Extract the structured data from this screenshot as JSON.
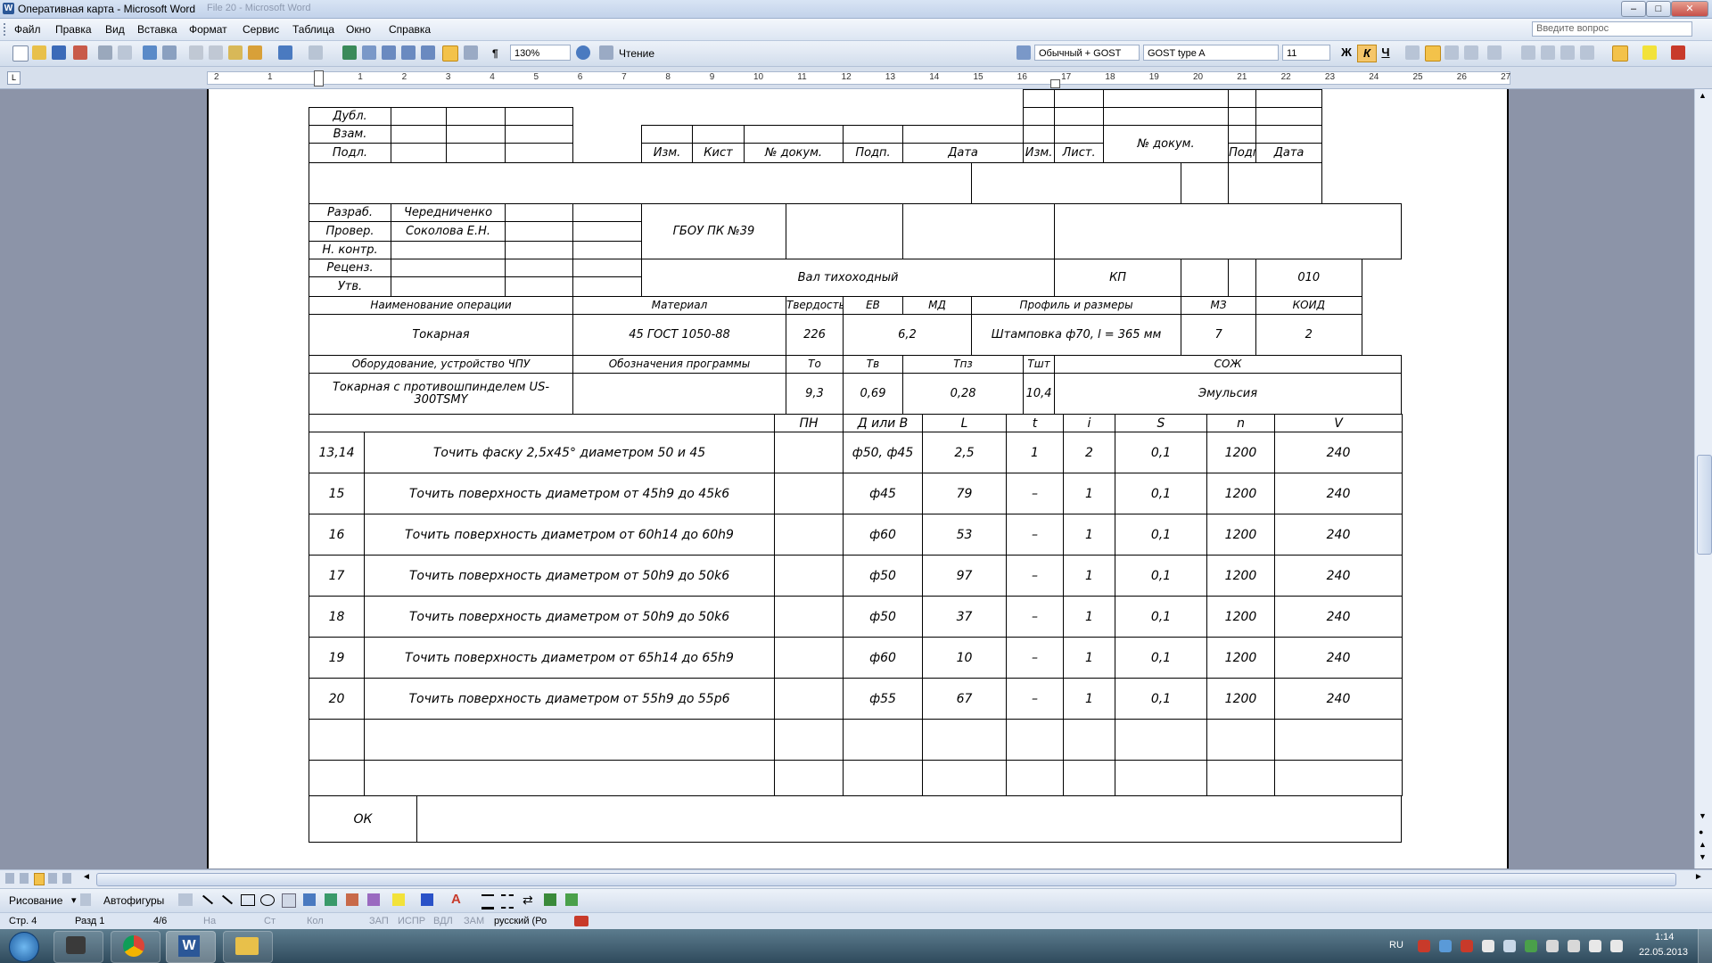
{
  "window": {
    "title": "Оперативная карта - Microsoft Word",
    "ghost_title": "File 20 - Microsoft Word",
    "minimize": "–",
    "maximize": "□",
    "close": "✕"
  },
  "menu": {
    "items": [
      "Файл",
      "Правка",
      "Вид",
      "Вставка",
      "Формат",
      "Сервис",
      "Таблица",
      "Окно",
      "Справка"
    ],
    "ask_placeholder": "Введите вопрос"
  },
  "toolbar": {
    "zoom": "130%",
    "reading_label": "Чтение",
    "style": "Обычный + GOST",
    "font": "GOST type A",
    "font_size": "11",
    "bold": "Ж",
    "italic": "К",
    "underline": "Ч"
  },
  "ruler": {
    "numbers": [
      "2",
      "1",
      "1",
      "2",
      "3",
      "4",
      "5",
      "6",
      "7",
      "8",
      "9",
      "10",
      "11",
      "12",
      "13",
      "14",
      "15",
      "16",
      "17",
      "18",
      "19",
      "20",
      "21",
      "22",
      "23",
      "24",
      "25",
      "26",
      "27"
    ]
  },
  "form": {
    "dubl": "Дубл.",
    "vzam": "Взам.",
    "podl": "Подл.",
    "col_izm": "Изм.",
    "col_list1": "Кист",
    "col_dokum": "№ докум.",
    "col_podp": "Подп.",
    "col_data": "Дата",
    "col_izm2": "Изм.",
    "col_list2": "Лист.",
    "col_dokum2": "№ докум.",
    "col_podp2": "Подп.",
    "col_data2": "Дата",
    "razrab": "Разраб.",
    "razrab_name": "Чередниченко",
    "prover": "Провер.",
    "prover_name": "Соколова Е.Н.",
    "nkontr": "Н. контр.",
    "recenz": "Реценз.",
    "utv": "Утв.",
    "org": "ГБОУ ПК №39",
    "part_name": "Вал тихоходный",
    "kp": "КП",
    "kp_num": "010",
    "h_operation": "Наименование операции",
    "h_material": "Материал",
    "h_hardness": "Твердость",
    "h_ev": "ЕВ",
    "h_md": "МД",
    "h_profile": "Профиль и размеры",
    "h_mz": "МЗ",
    "h_koid": "КОИД",
    "operation": "Токарная",
    "material": "45 ГОСТ 1050-88",
    "hardness": "226",
    "ev_md": "6,2",
    "profile": "Штамповка ф70, l = 365 мм",
    "mz": "7",
    "koid": "2",
    "h_equipment": "Оборудование, устройство ЧПУ",
    "h_program": "Обозначения программы",
    "h_to": "То",
    "h_tv": "Тв",
    "h_tpz": "Тпз",
    "h_tsht": "Тшт",
    "h_soj": "СОЖ",
    "equipment": "Токарная с противошпинделем US-300TSMY",
    "to": "9,3",
    "tv": "0,69",
    "tpz": "0,28",
    "tsht": "10,4",
    "soj": "Эмульсия",
    "h_pn": "ПН",
    "h_d": "Д или В",
    "h_l": "L",
    "h_t": "t",
    "h_i": "i",
    "h_s": "S",
    "h_n": "n",
    "h_v": "V",
    "ok": "ОК"
  },
  "operations": [
    {
      "num": "13,14",
      "desc": "Точить фаску 2,5х45° диаметром 50 и 45",
      "pn": "",
      "d": "ф50, ф45",
      "l": "2,5",
      "t": "1",
      "i": "2",
      "s": "0,1",
      "n": "1200",
      "v": "240"
    },
    {
      "num": "15",
      "desc": "Точить поверхность диаметром от 45h9 до 45k6",
      "pn": "",
      "d": "ф45",
      "l": "79",
      "t": "–",
      "i": "1",
      "s": "0,1",
      "n": "1200",
      "v": "240"
    },
    {
      "num": "16",
      "desc": "Точить поверхность диаметром от 60h14 до 60h9",
      "pn": "",
      "d": "ф60",
      "l": "53",
      "t": "–",
      "i": "1",
      "s": "0,1",
      "n": "1200",
      "v": "240"
    },
    {
      "num": "17",
      "desc": "Точить поверхность диаметром от 50h9 до 50k6",
      "pn": "",
      "d": "ф50",
      "l": "97",
      "t": "–",
      "i": "1",
      "s": "0,1",
      "n": "1200",
      "v": "240"
    },
    {
      "num": "18",
      "desc": "Точить поверхность диаметром от 50h9 до 50k6",
      "pn": "",
      "d": "ф50",
      "l": "37",
      "t": "–",
      "i": "1",
      "s": "0,1",
      "n": "1200",
      "v": "240"
    },
    {
      "num": "19",
      "desc": "Точить поверхность диаметром от 65h14 до 65h9",
      "pn": "",
      "d": "ф60",
      "l": "10",
      "t": "–",
      "i": "1",
      "s": "0,1",
      "n": "1200",
      "v": "240"
    },
    {
      "num": "20",
      "desc": "Точить поверхность диаметром от 55h9 до 55p6",
      "pn": "",
      "d": "ф55",
      "l": "67",
      "t": "–",
      "i": "1",
      "s": "0,1",
      "n": "1200",
      "v": "240"
    }
  ],
  "drawing": {
    "draw_label": "Рисование",
    "autoshapes_label": "Автофигуры"
  },
  "status": {
    "page": "Стр. 4",
    "section": "Разд 1",
    "pages": "4/6",
    "at": "На",
    "line": "Ст",
    "col": "Кол",
    "rec": "ЗАП",
    "trk": "ИСПР",
    "ext": "ВДЛ",
    "ovr": "ЗАМ",
    "lang": "русский (Ро"
  },
  "taskbar": {
    "lang": "RU",
    "time": "1:14",
    "date": "22.05.2013"
  }
}
